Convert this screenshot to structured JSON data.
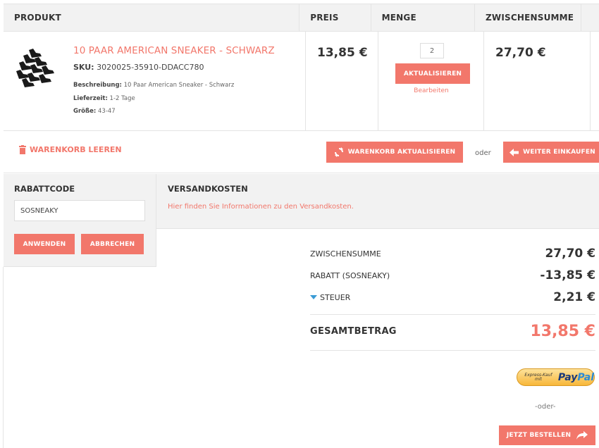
{
  "table": {
    "headers": {
      "product": "PRODUKT",
      "price": "PREIS",
      "quantity": "MENGE",
      "subtotal": "ZWISCHENSUMME"
    }
  },
  "item": {
    "name": "10 PAAR AMERICAN SNEAKER - SCHWARZ",
    "sku_label": "SKU:",
    "sku": "3020025-35910-DDACC780",
    "description_label": "Beschreibung:",
    "description": "10 Paar American Sneaker - Schwarz",
    "delivery_label": "Lieferzeit:",
    "delivery": "1-2 Tage",
    "size_label": "Größe:",
    "size": "43-47",
    "price": "13,85 €",
    "quantity": "2",
    "update_label": "AKTUALISIEREN",
    "edit_label": "Bearbeiten",
    "subtotal": "27,70 €"
  },
  "actions": {
    "clear_cart": "WARENKORB LEEREN",
    "update_cart": "WARENKORB AKTUALISIEREN",
    "or": "oder",
    "continue_shopping": "WEITER EINKAUFEN"
  },
  "coupon": {
    "title": "RABATTCODE",
    "value": "SOSNEAKY",
    "apply": "ANWENDEN",
    "cancel": "ABBRECHEN"
  },
  "shipping": {
    "title": "VERSANDKOSTEN",
    "info": "Hier finden Sie Informationen zu den Versandkosten."
  },
  "totals": {
    "subtotal_label": "ZWISCHENSUMME",
    "subtotal": "27,70 €",
    "discount_label": "RABATT (SOSNEAKY)",
    "discount": "-13,85 €",
    "tax_label": "STEUER",
    "tax": "2,21 €",
    "grand_label": "GESAMTBETRAG",
    "grand": "13,85 €"
  },
  "checkout": {
    "paypal_small": "Express-Kauf mit",
    "paypal_pay": "Pay",
    "paypal_pal": "Pal",
    "or": "-oder-",
    "order_now": "JETZT BESTELLEN"
  },
  "colors": {
    "accent": "#f2776b",
    "panel": "#f2f2f2",
    "tax_arrow": "#3a9bd5"
  }
}
